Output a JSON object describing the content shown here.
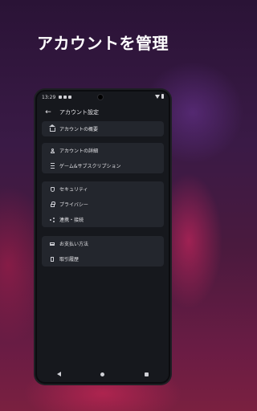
{
  "hero": {
    "title": "アカウントを管理"
  },
  "statusbar": {
    "time": "13:29"
  },
  "appbar": {
    "title": "アカウント設定"
  },
  "groups": [
    {
      "items": [
        {
          "label": "アカウントの概要",
          "icon": "home-icon"
        }
      ]
    },
    {
      "items": [
        {
          "label": "アカウントの詳細",
          "icon": "user-icon"
        },
        {
          "label": "ゲーム&サブスクリプション",
          "icon": "list-icon"
        }
      ]
    },
    {
      "items": [
        {
          "label": "セキュリティ",
          "icon": "shield-icon"
        },
        {
          "label": "プライバシー",
          "icon": "lock-icon"
        },
        {
          "label": "連携・接続",
          "icon": "share-icon"
        }
      ]
    },
    {
      "items": [
        {
          "label": "お支払い方法",
          "icon": "card-icon"
        },
        {
          "label": "取引履歴",
          "icon": "document-icon"
        }
      ]
    }
  ],
  "colors": {
    "screen_bg": "#16181d",
    "card_bg": "#23262d",
    "text": "#e4e4e8"
  }
}
